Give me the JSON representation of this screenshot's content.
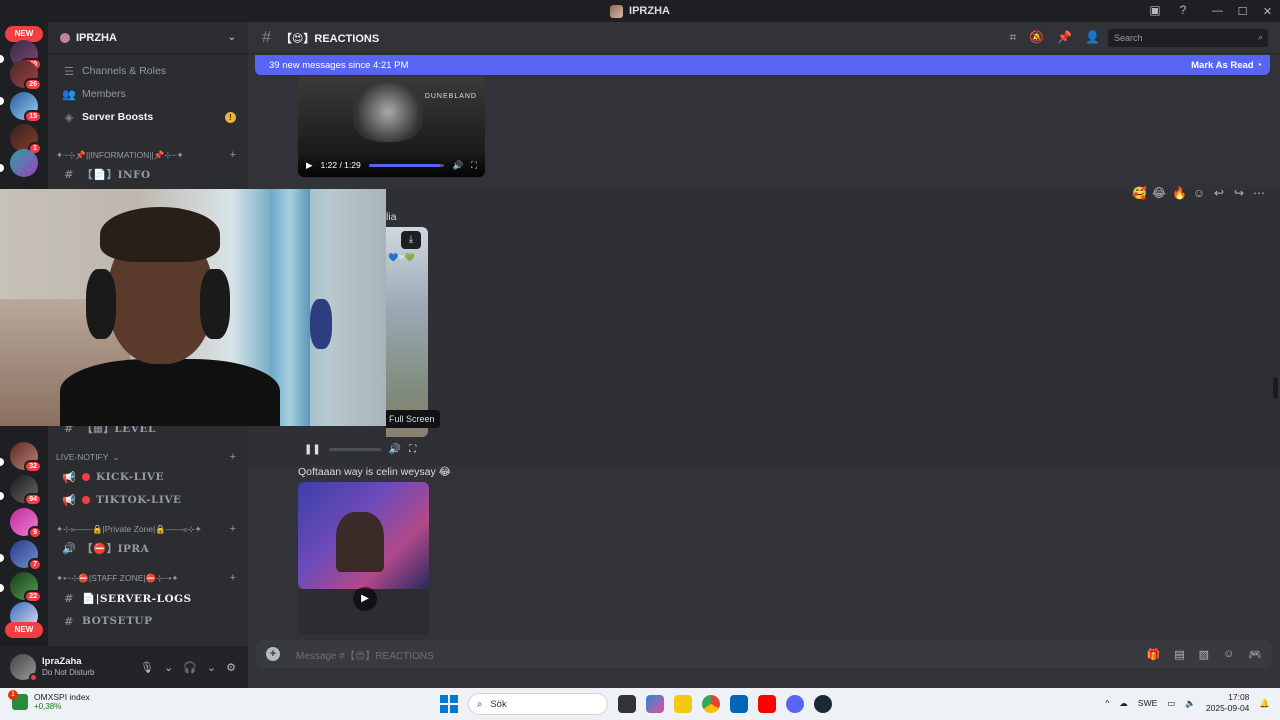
{
  "window": {
    "title": "IPRZHA"
  },
  "rail": {
    "new_top": "NEW",
    "new_bottom": "NEW",
    "badges": [
      "340",
      "26",
      "15",
      "1",
      "32",
      "94",
      "9",
      "7",
      "22"
    ]
  },
  "server": {
    "name": "IPRZHA",
    "menu_items": [
      {
        "label": "Channels & Roles",
        "icon": "list-icon"
      },
      {
        "label": "Members",
        "icon": "members-icon"
      },
      {
        "label": "Server Boosts",
        "icon": "boost-icon"
      }
    ],
    "categories": {
      "information": "✦┈⊹📌||INFORMATION||📌⊹┈✦",
      "live_notify": "LIVE-NOTIFY",
      "private_zone": "✦⊹»——🔒|Private Zone|🔒——«⊹✦",
      "staff_zone": "✦•┈⊹⛔|STAFF ZONE|⛔⊹┈•✦"
    },
    "channels": {
      "info": "【📄】INFO",
      "level": "【▦】LEVEL",
      "kick_live": "KICK-LIVE",
      "tiktok_live": "TIKTOK-LIVE",
      "ipra": "【⛔】IPRA",
      "server_logs": "📄|SERVER-LOGS",
      "botsetup": "BOTSETUP"
    }
  },
  "user": {
    "name": "IpraZaha",
    "status": "Do Not Disturb"
  },
  "channel": {
    "name": "【😍】REACTIONS",
    "search_placeholder": "Search"
  },
  "new_messages": {
    "text": "39 new messages since 4:21 PM",
    "action": "Mark As Read"
  },
  "messages": {
    "video1_time": "1:22 / 1:29",
    "video1_progress": 0.94,
    "video1_watermark": "DUNEBLAND",
    "fragment_text": "lia",
    "tooltip": "Full Screen",
    "msg3_text": "Qoftaaan way is celin weysay 😂"
  },
  "composer": {
    "placeholder": "Message #【😍】REACTIONS"
  },
  "taskbar": {
    "widget_title": "OMXSPI index",
    "widget_change": "+0,38%",
    "widget_badge": "1",
    "search": "Sök",
    "lang": "SWE",
    "time": "17:08",
    "date": "2025-09-04"
  },
  "colors": {
    "accent": "#5865f2",
    "danger": "#f23f42",
    "warning": "#f0b232"
  }
}
